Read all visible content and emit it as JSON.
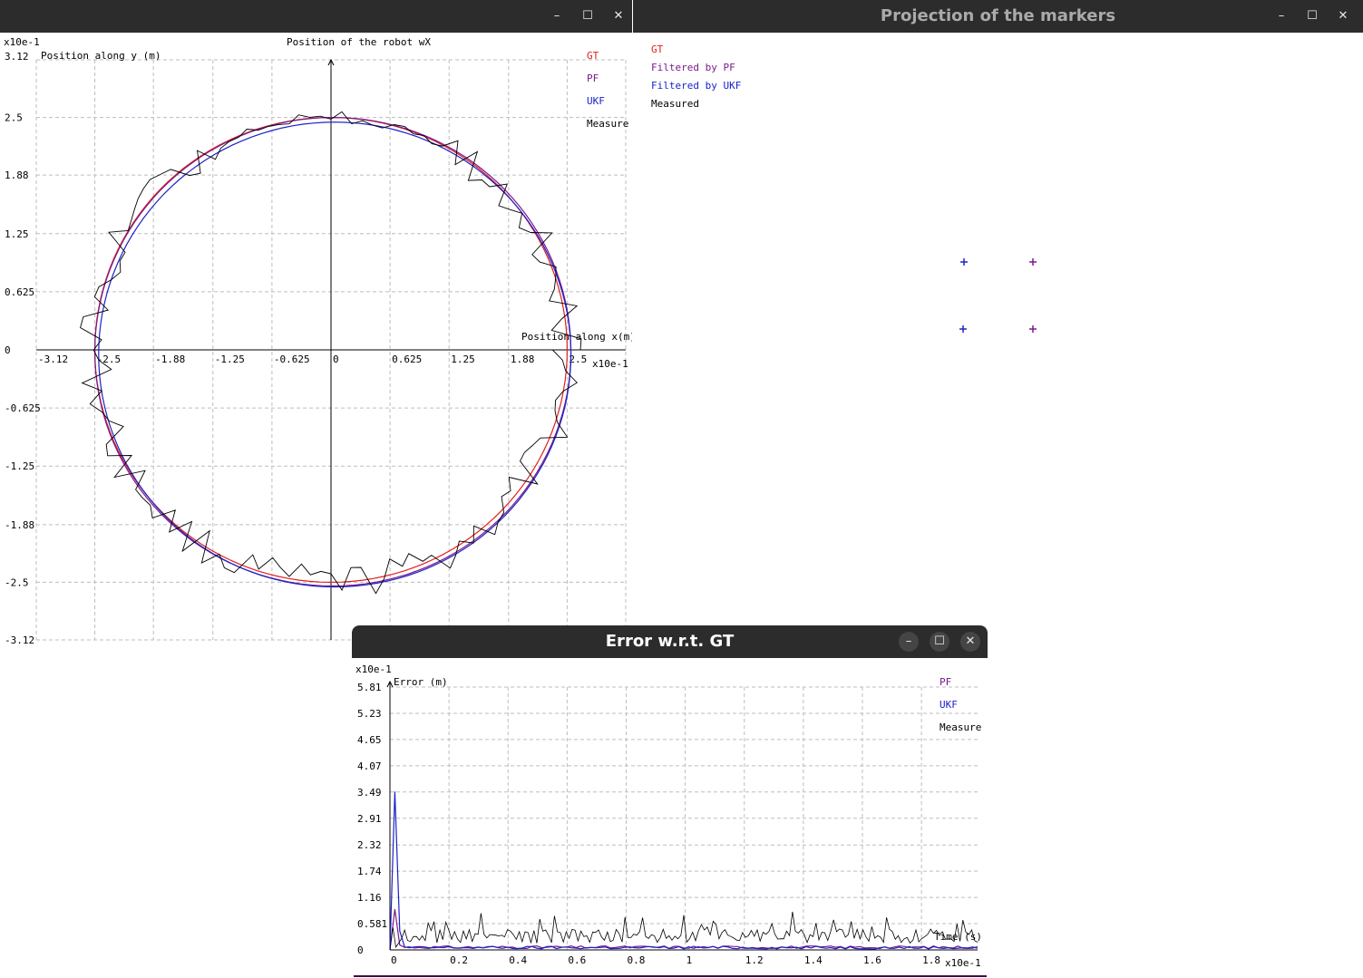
{
  "colors": {
    "gt": "#e0201c",
    "pf": "#7a1a8c",
    "ukf": "#1c22c8",
    "measure": "#000000",
    "titlebar": "#2c2c2c",
    "title_text": "#aaaaaa",
    "title_text_active": "#ffffff"
  },
  "window_position": {
    "title": "",
    "controls": {
      "minimize": "–",
      "maximize": "☐",
      "close": "✕"
    },
    "chart_data": {
      "type": "line",
      "title": "Position of the robot wX",
      "xlabel": "Position along x(m)",
      "ylabel": "Position along y (m)",
      "x_scale_label": "x10e-1",
      "y_scale_label": "x10e-1",
      "xlim": [
        -3.12,
        3.12
      ],
      "ylim": [
        -3.12,
        3.12
      ],
      "x_ticks": [
        "-3.12",
        "-2.5",
        "-1.88",
        "-1.25",
        "-0.625",
        "0",
        "0.625",
        "1.25",
        "1.88",
        "2.5"
      ],
      "y_ticks": [
        "3.12",
        "2.5",
        "1.88",
        "1.25",
        "0.625",
        "0",
        "-0.625",
        "-1.25",
        "-1.88",
        "-2.5",
        "-3.12"
      ],
      "grid": true,
      "legend": [
        "GT",
        "PF",
        "UKF",
        "Measure"
      ],
      "series": [
        {
          "name": "GT",
          "shape": "circle",
          "center": [
            0,
            0
          ],
          "radius": 2.5
        },
        {
          "name": "PF",
          "shape": "circle",
          "center": [
            0.02,
            -0.02
          ],
          "radius": 2.52
        },
        {
          "name": "UKF",
          "shape": "circle",
          "center": [
            0.04,
            -0.05
          ],
          "radius": 2.5
        },
        {
          "name": "Measure",
          "shape": "noisy-circle",
          "center": [
            0,
            0
          ],
          "radius": 2.5,
          "noise": 0.18
        }
      ]
    }
  },
  "window_projection": {
    "title": "Projection of the markers",
    "controls": {
      "minimize": "–",
      "maximize": "☐",
      "close": "✕"
    },
    "legend": [
      "GT",
      "Filtered by PF",
      "Filtered by UKF",
      "Measured"
    ],
    "markers_count_note": ""
  },
  "window_error": {
    "title": "Error w.r.t. GT",
    "controls": {
      "minimize": "–",
      "maximize": "☐",
      "close": "✕"
    },
    "chart_data": {
      "type": "line",
      "title": "",
      "xlabel": "Time (s)",
      "ylabel": "Error (m)",
      "x_scale_label": "x10e-1",
      "y_scale_label": "x10e-1",
      "xlim": [
        0,
        1.99
      ],
      "ylim": [
        0,
        5.81
      ],
      "x_ticks": [
        "0",
        "0.2",
        "0.4",
        "0.6",
        "0.8",
        "1",
        "1.2",
        "1.4",
        "1.6",
        "1.8"
      ],
      "y_ticks": [
        "5.81",
        "5.23",
        "4.65",
        "4.07",
        "3.49",
        "2.91",
        "2.32",
        "1.74",
        "1.16",
        "0.581",
        "0"
      ],
      "grid": true,
      "legend": [
        "PF",
        "UKF",
        "Measure"
      ],
      "series": [
        {
          "name": "PF",
          "initial_peak": 0.9,
          "baseline": 0.03
        },
        {
          "name": "UKF",
          "initial_peak": 3.5,
          "baseline": 0.02
        },
        {
          "name": "Measure",
          "initial_peak": 0.5,
          "baseline": 0.15,
          "noise": 0.45
        }
      ]
    }
  }
}
